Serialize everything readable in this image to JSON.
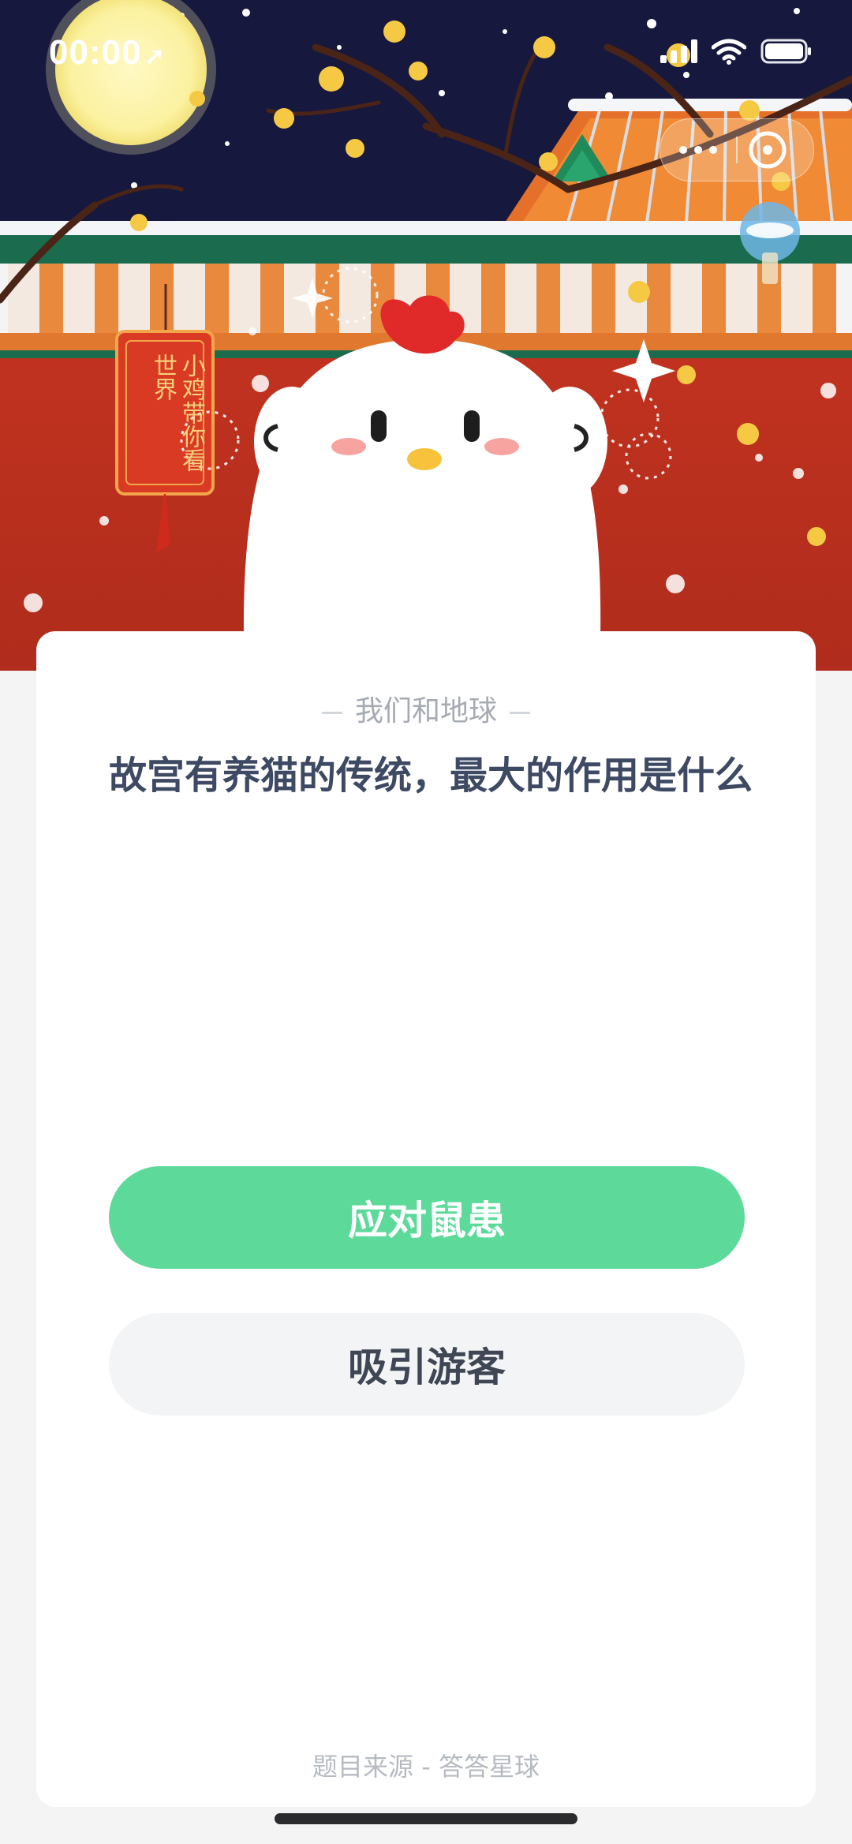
{
  "status_bar": {
    "time": "00:00"
  },
  "capsule": {
    "more_icon": "more-dots-icon",
    "close_icon": "close-circle-icon"
  },
  "hero": {
    "tag_text": "小鸡带你看世界"
  },
  "card": {
    "source_title": "我们和地球",
    "question": "故宫有养猫的传统，最大的作用是什么",
    "options": [
      "应对鼠患",
      "吸引游客"
    ],
    "footer": "题目来源 - 答答星球"
  },
  "colors": {
    "night_sky": "#16183e",
    "palace_wall": "#b8311f",
    "correct_green": "#5dda9a",
    "question_text": "#3e4a63"
  }
}
